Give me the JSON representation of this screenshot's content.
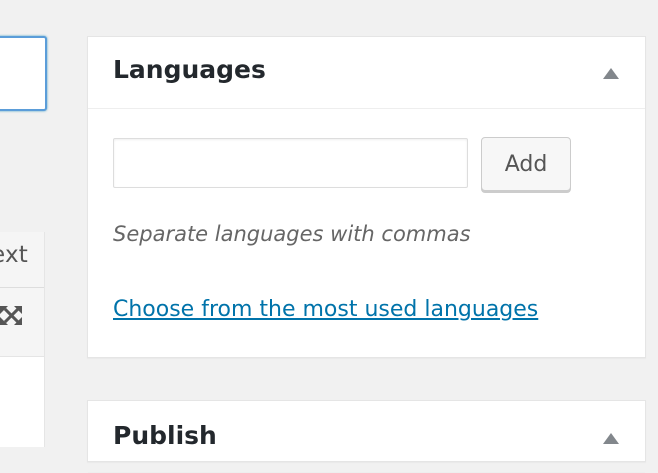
{
  "editor": {
    "tab_text": "ext",
    "expand_icon": "fullscreen-icon"
  },
  "languages_box": {
    "title": "Languages",
    "toggle_icon": "arrow-up-icon",
    "input": {
      "value": "",
      "placeholder": ""
    },
    "add_label": "Add",
    "howto": "Separate languages with commas",
    "most_used_link": "Choose from the most used languages"
  },
  "publish_box": {
    "title": "Publish",
    "toggle_icon": "arrow-up-icon"
  },
  "colors": {
    "link": "#0073aa",
    "focus_border": "#5b9dd9",
    "background": "#f1f1f1"
  }
}
